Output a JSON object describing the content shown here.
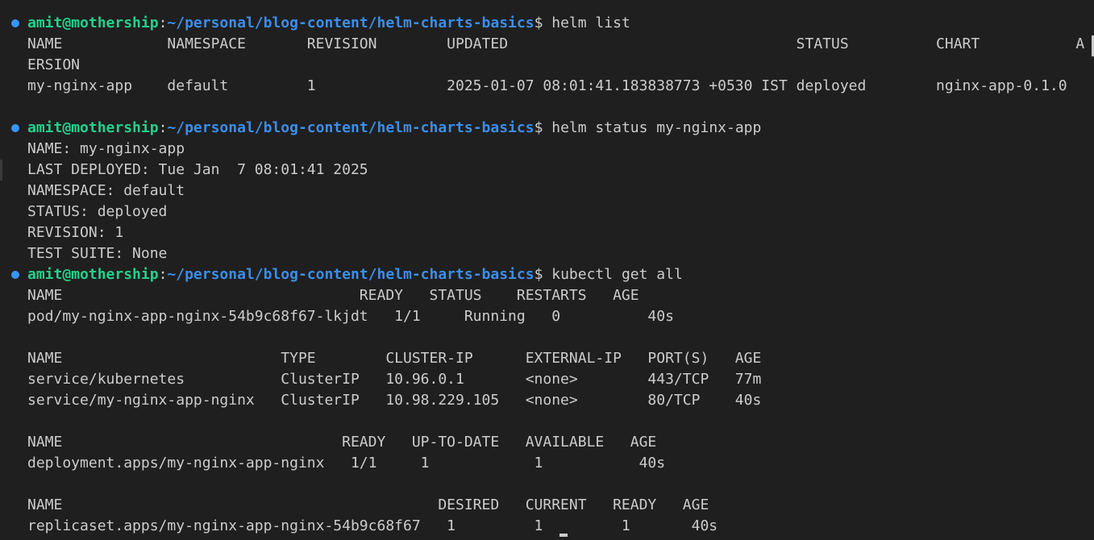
{
  "theme": {
    "background": "#1f1f1f",
    "foreground": "#cccccc",
    "user_color": "#23d18b",
    "path_color": "#3b8eea",
    "dot_color": "#3794ff"
  },
  "prompt": {
    "user": "amit@mothership",
    "path": "~/personal/blog-content/helm-charts-basics",
    "suffix": "$ "
  },
  "lines": [
    {
      "type": "prompt",
      "command": "helm list"
    },
    {
      "type": "out",
      "text": "NAME            NAMESPACE       REVISION        UPDATED                                 STATUS          CHART           A"
    },
    {
      "type": "out",
      "text": "ERSION"
    },
    {
      "type": "out",
      "text": "my-nginx-app    default         1               2025-01-07 08:01:41.183838773 +0530 IST deployed        nginx-app-0.1.0"
    },
    {
      "type": "out",
      "text": ""
    },
    {
      "type": "prompt",
      "command": "helm status my-nginx-app"
    },
    {
      "type": "out",
      "text": "NAME: my-nginx-app"
    },
    {
      "type": "out",
      "text": "LAST DEPLOYED: Tue Jan  7 08:01:41 2025"
    },
    {
      "type": "out",
      "text": "NAMESPACE: default"
    },
    {
      "type": "out",
      "text": "STATUS: deployed"
    },
    {
      "type": "out",
      "text": "REVISION: 1"
    },
    {
      "type": "out",
      "text": "TEST SUITE: None"
    },
    {
      "type": "prompt",
      "command": "kubectl get all"
    },
    {
      "type": "out",
      "text": "NAME                                  READY   STATUS    RESTARTS   AGE"
    },
    {
      "type": "out",
      "text": "pod/my-nginx-app-nginx-54b9c68f67-lkjdt   1/1     Running   0          40s"
    },
    {
      "type": "out",
      "text": ""
    },
    {
      "type": "out",
      "text": "NAME                         TYPE        CLUSTER-IP      EXTERNAL-IP   PORT(S)   AGE"
    },
    {
      "type": "out",
      "text": "service/kubernetes           ClusterIP   10.96.0.1       <none>        443/TCP   77m"
    },
    {
      "type": "out",
      "text": "service/my-nginx-app-nginx   ClusterIP   10.98.229.105   <none>        80/TCP    40s"
    },
    {
      "type": "out",
      "text": ""
    },
    {
      "type": "out",
      "text": "NAME                                READY   UP-TO-DATE   AVAILABLE   AGE"
    },
    {
      "type": "out",
      "text": "deployment.apps/my-nginx-app-nginx   1/1     1            1           40s"
    },
    {
      "type": "out",
      "text": ""
    },
    {
      "type": "out",
      "text": "NAME                                           DESIRED   CURRENT   READY   AGE"
    },
    {
      "type": "out",
      "text": "replicaset.apps/my-nginx-app-nginx-54b9c68f67   1         1         1       40s"
    }
  ]
}
